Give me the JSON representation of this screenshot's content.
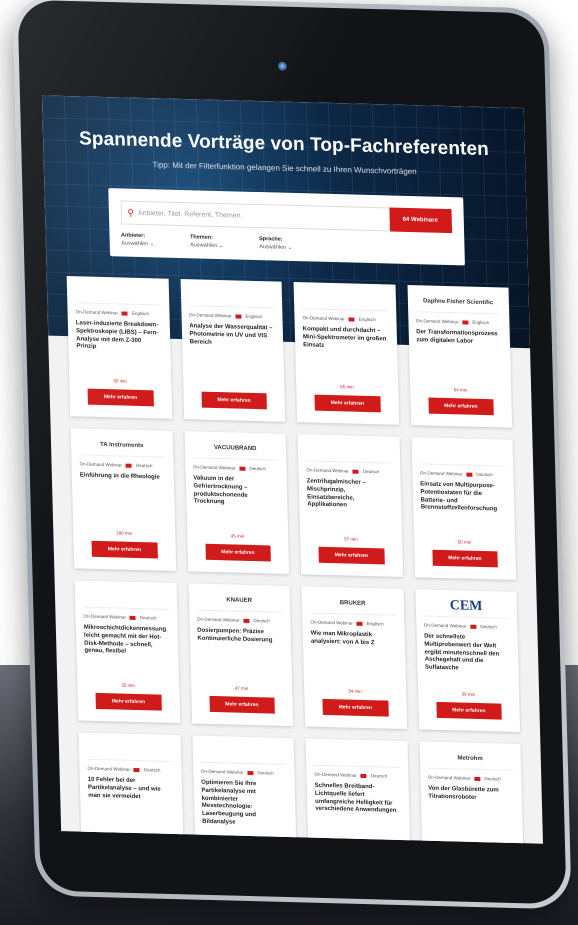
{
  "hero": {
    "title": "Spannende Vorträge von Top-Fachreferenten",
    "subtitle": "Tipp: Mit der Filterfunktion gelangen Sie schnell zu Ihren Wunschvorträgen"
  },
  "search": {
    "placeholder": "Anbieter, Titel, Referent, Themen",
    "button_label": "64 Webinare"
  },
  "filters": [
    {
      "label": "Anbieter:",
      "value": "Auswählen"
    },
    {
      "label": "Themen:",
      "value": "Auswählen"
    },
    {
      "label": "Sprache:",
      "value": "Auswählen"
    }
  ],
  "cards": [
    {
      "logo": "",
      "meta": "On-Demand Webinar",
      "lang": "Englisch",
      "title": "Laser-induzierte Breakdown-Spektroskopie (LIBS) – Fern-Analyse mit dem Z-300 Prinzip",
      "dur": "32 min",
      "cta": "Mehr erfahren"
    },
    {
      "logo": "",
      "meta": "On-Demand Webinar",
      "lang": "Englisch",
      "title": "Analyse der Wasserqualität – Photometrie im UV und VIS Bereich",
      "dur": "",
      "cta": "Mehr erfahren"
    },
    {
      "logo": "",
      "meta": "On-Demand Webinar",
      "lang": "Englisch",
      "title": "Kompakt und durchdacht – Mini-Spektrometer im großen Einsatz",
      "dur": "55 min",
      "cta": "Mehr erfahren"
    },
    {
      "logo": "Daphne Fisher Scientific",
      "meta": "On-Demand Webinar",
      "lang": "Englisch",
      "title": "Der Transformationsprozess zum digitalen Labor",
      "dur": "54 min",
      "cta": "Mehr erfahren"
    },
    {
      "logo": "TA Instruments",
      "meta": "On-Demand Webinar",
      "lang": "Deutsch",
      "title": "Einführung in die Rheologie",
      "dur": "180 min",
      "cta": "Mehr erfahren"
    },
    {
      "logo": "VACUUBRAND",
      "meta": "On-Demand Webinar",
      "lang": "Deutsch",
      "title": "Vakuum in der Gefriertrocknung – produktschonende Trocknung",
      "dur": "45 min",
      "cta": "Mehr erfahren"
    },
    {
      "logo": "",
      "meta": "On-Demand Webinar",
      "lang": "Deutsch",
      "title": "Zentrifugalmischer – Mischprinzip, Einsatzbereiche, Applikationen",
      "dur": "57 min",
      "cta": "Mehr erfahren"
    },
    {
      "logo": "",
      "meta": "On-Demand Webinar",
      "lang": "Deutsch",
      "title": "Einsatz von Multipurpose-Potentiostaten für die Batterie- und Brennstoffzellenforschung",
      "dur": "50 min",
      "cta": "Mehr erfahren"
    },
    {
      "logo": "",
      "meta": "On-Demand Webinar",
      "lang": "Deutsch",
      "title": "Mikroschichtdickenmessung leicht gemacht mit der Hot-Disk-Methode – schnell, genau, flexibel",
      "dur": "35 min",
      "cta": "Mehr erfahren"
    },
    {
      "logo": "KNAUER",
      "meta": "On-Demand Webinar",
      "lang": "Deutsch",
      "title": "Dosierpumpen: Präzise Kontinuierliche Dosierung",
      "dur": "47 min",
      "cta": "Mehr erfahren"
    },
    {
      "logo": "BRUKER",
      "meta": "On-Demand Webinar",
      "lang": "Englisch",
      "title": "Wie man Mikroplastik analysiert: von A bis Z",
      "dur": "34 min",
      "cta": "Mehr erfahren"
    },
    {
      "logo": "CEM",
      "meta": "On-Demand Webinar",
      "lang": "Deutsch",
      "title": "Der schnellste Multiprobenwert der Welt ergibt minutenschnell den Aschegehalt und die Sulfatasche",
      "dur": "30 min",
      "cta": "Mehr erfahren"
    },
    {
      "logo": "",
      "meta": "On-Demand Webinar",
      "lang": "Deutsch",
      "title": "10 Fehler bei der Partikelanalyse – und wie man sie vermeidet",
      "dur": "",
      "cta": ""
    },
    {
      "logo": "",
      "meta": "On-Demand Webinar",
      "lang": "Deutsch",
      "title": "Optimieren Sie Ihre Partikelanalyse mit kombinierter Messtechnologie: Laserbeugung und Bildanalyse",
      "dur": "",
      "cta": ""
    },
    {
      "logo": "",
      "meta": "On-Demand Webinar",
      "lang": "Deutsch",
      "title": "Schnelles Breitband-Lichtquelle liefert umfangreiche Helligkeit für verschiedene Anwendungen",
      "dur": "",
      "cta": ""
    },
    {
      "logo": "Metrohm",
      "meta": "On-Demand Webinar",
      "lang": "Deutsch",
      "title": "Von der Glasbürette zum Titrationsroboter",
      "dur": "",
      "cta": ""
    }
  ]
}
